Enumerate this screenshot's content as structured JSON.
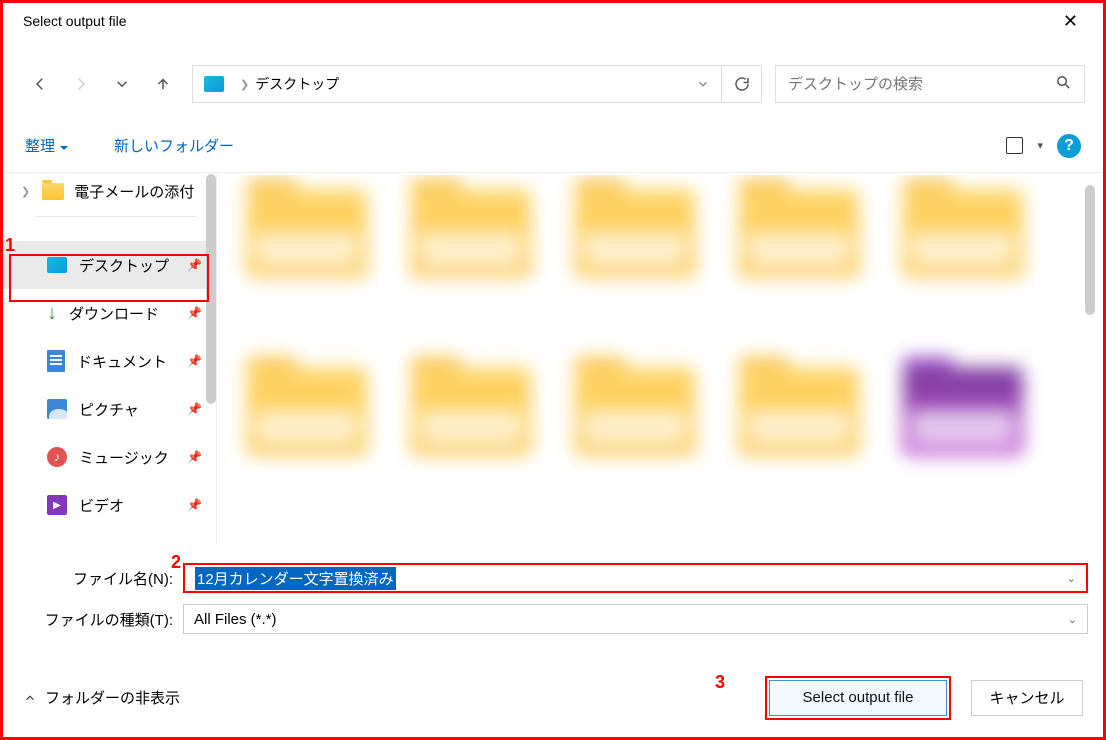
{
  "title": "Select output file",
  "breadcrumb": {
    "location": "デスクトップ"
  },
  "search": {
    "placeholder": "デスクトップの検索"
  },
  "toolbar": {
    "organize": "整理",
    "new_folder": "新しいフォルダー"
  },
  "sidebar": {
    "tree_item": "電子メールの添付",
    "items": [
      {
        "label": "デスクトップ",
        "icon": "desktop"
      },
      {
        "label": "ダウンロード",
        "icon": "download"
      },
      {
        "label": "ドキュメント",
        "icon": "document"
      },
      {
        "label": "ピクチャ",
        "icon": "pictures"
      },
      {
        "label": "ミュージック",
        "icon": "music"
      },
      {
        "label": "ビデオ",
        "icon": "video"
      }
    ]
  },
  "form": {
    "filename_label": "ファイル名(N):",
    "filename_value": "12月カレンダー文字置換済み",
    "filetype_label": "ファイルの種類(T):",
    "filetype_value": "All Files (*.*)"
  },
  "footer": {
    "hide_folders": "フォルダーの非表示",
    "primary": "Select output file",
    "cancel": "キャンセル"
  },
  "annotations": {
    "one": "1",
    "two": "2",
    "three": "3"
  }
}
